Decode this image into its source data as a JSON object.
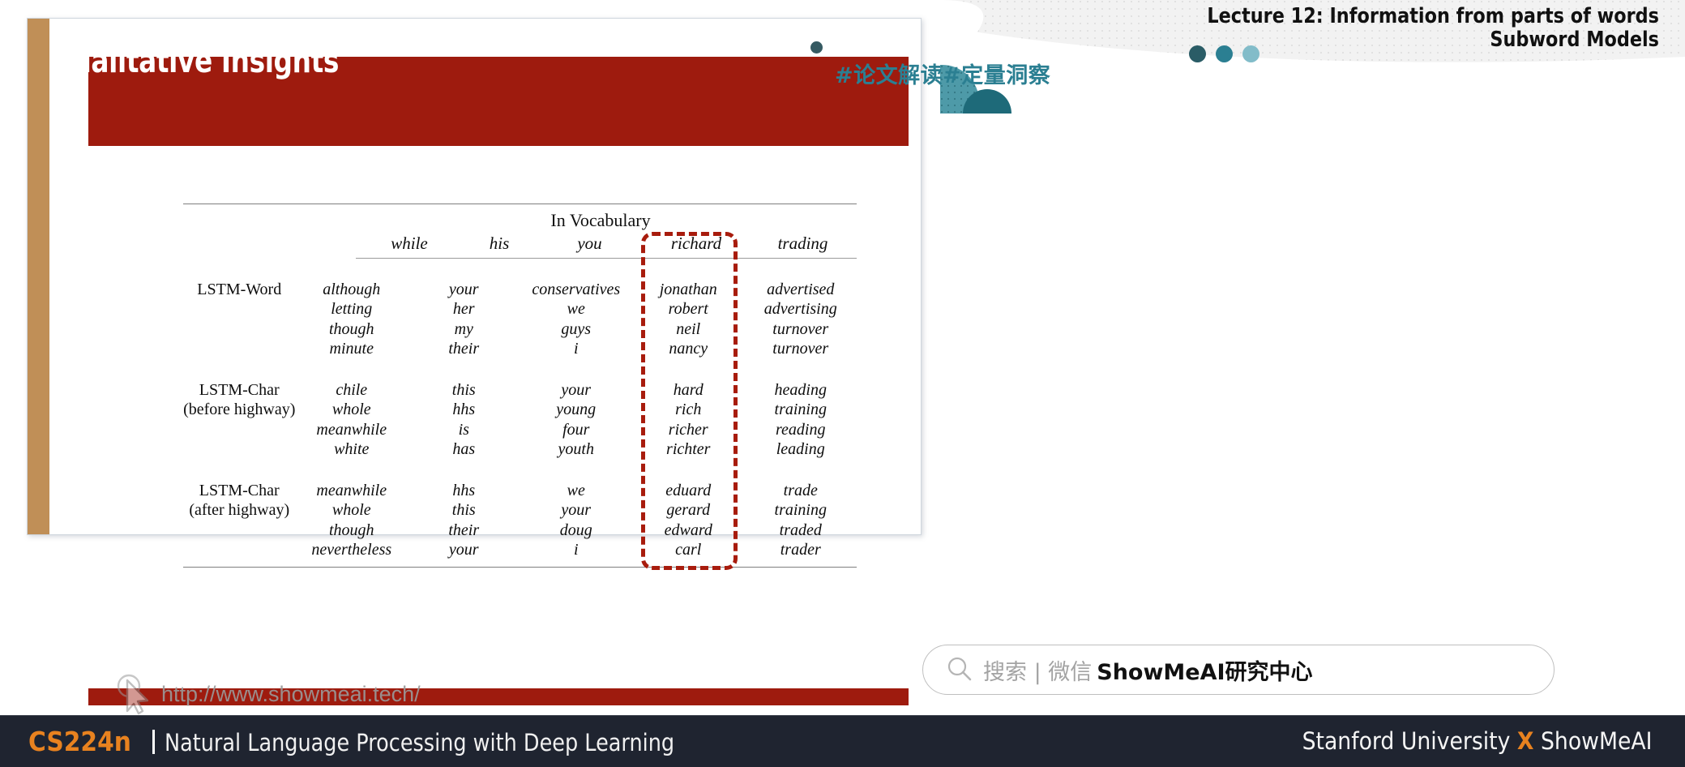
{
  "slide": {
    "title": "Qualitative Insights",
    "watermark_url": "http://www.showmeai.tech/",
    "accent_color": "#9e1b0e",
    "stripe_color": "#c08f57"
  },
  "figure": {
    "group_header": "In Vocabulary",
    "column_headers": [
      "while",
      "his",
      "you",
      "richard",
      "trading"
    ],
    "row_labels": [
      "LSTM-Word",
      "LSTM-Char\n(before highway)",
      "LSTM-Char\n(after highway)"
    ],
    "rows": [
      {
        "label_line1": "LSTM-Word",
        "label_line2": "",
        "columns": [
          [
            "although",
            "letting",
            "though",
            "minute"
          ],
          [
            "your",
            "her",
            "my",
            "their"
          ],
          [
            "conservatives",
            "we",
            "guys",
            "i"
          ],
          [
            "jonathan",
            "robert",
            "neil",
            "nancy"
          ],
          [
            "advertised",
            "advertising",
            "turnover",
            "turnover"
          ]
        ]
      },
      {
        "label_line1": "LSTM-Char",
        "label_line2": "(before highway)",
        "columns": [
          [
            "chile",
            "whole",
            "meanwhile",
            "white"
          ],
          [
            "this",
            "hhs",
            "is",
            "has"
          ],
          [
            "your",
            "young",
            "four",
            "youth"
          ],
          [
            "hard",
            "rich",
            "richer",
            "richter"
          ],
          [
            "heading",
            "training",
            "reading",
            "leading"
          ]
        ]
      },
      {
        "label_line1": "LSTM-Char",
        "label_line2": "(after highway)",
        "columns": [
          [
            "meanwhile",
            "whole",
            "though",
            "nevertheless"
          ],
          [
            "hhs",
            "this",
            "their",
            "your"
          ],
          [
            "we",
            "your",
            "doug",
            "i"
          ],
          [
            "eduard",
            "gerard",
            "edward",
            "carl"
          ],
          [
            "trade",
            "training",
            "traded",
            "trader"
          ]
        ]
      }
    ],
    "highlight": {
      "column": "richard",
      "color": "#a81c0d",
      "style": "dashed"
    }
  },
  "header": {
    "lecture_line1": "Lecture 12: Information from parts of words",
    "lecture_line2": "Subword Models",
    "hashtag": "#论文解读#定量洞察",
    "dot_colors": [
      "#2a5c66",
      "#2b7f92",
      "#82bcc9"
    ],
    "accent_teal": "#2b7f92"
  },
  "search": {
    "placeholder": "搜索 | 微信",
    "brand": "ShowMeAI研究中心",
    "icon": "search-icon"
  },
  "footer": {
    "course_code": "CS224n",
    "course_name": "Natural Language Processing with Deep Learning",
    "right_prefix": "Stanford University ",
    "right_x": "X",
    "right_suffix": " ShowMeAI",
    "accent_color": "#e8821f",
    "background": "#1f2430"
  }
}
